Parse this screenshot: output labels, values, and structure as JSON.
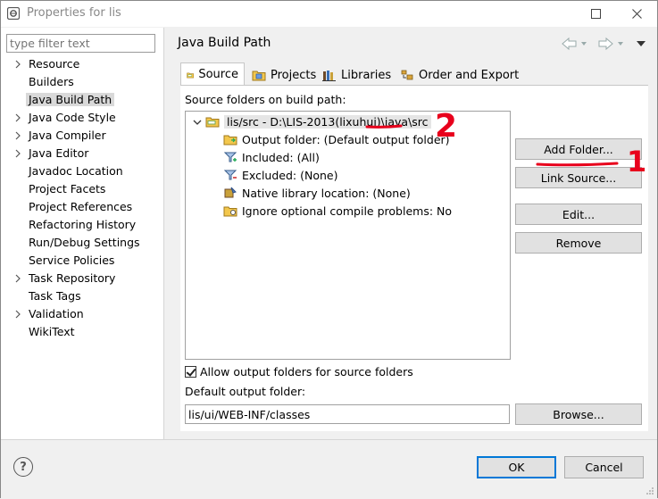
{
  "window": {
    "title": "Properties for lis"
  },
  "filter": {
    "placeholder": "type filter text"
  },
  "sidebar": {
    "items": [
      {
        "label": "Resource",
        "expandable": true
      },
      {
        "label": "Builders",
        "expandable": false
      },
      {
        "label": "Java Build Path",
        "expandable": false,
        "selected": true
      },
      {
        "label": "Java Code Style",
        "expandable": true
      },
      {
        "label": "Java Compiler",
        "expandable": true
      },
      {
        "label": "Java Editor",
        "expandable": true
      },
      {
        "label": "Javadoc Location",
        "expandable": false
      },
      {
        "label": "Project Facets",
        "expandable": false
      },
      {
        "label": "Project References",
        "expandable": false
      },
      {
        "label": "Refactoring History",
        "expandable": false
      },
      {
        "label": "Run/Debug Settings",
        "expandable": false
      },
      {
        "label": "Service Policies",
        "expandable": false
      },
      {
        "label": "Task Repository",
        "expandable": true
      },
      {
        "label": "Task Tags",
        "expandable": false
      },
      {
        "label": "Validation",
        "expandable": true
      },
      {
        "label": "WikiText",
        "expandable": false
      }
    ]
  },
  "page": {
    "title": "Java Build Path"
  },
  "tabs": [
    {
      "label": "Source",
      "icon": "source-folder-icon",
      "active": true
    },
    {
      "label": "Projects",
      "icon": "projects-icon",
      "active": false
    },
    {
      "label": "Libraries",
      "icon": "libraries-icon",
      "active": false
    },
    {
      "label": "Order and Export",
      "icon": "order-export-icon",
      "active": false
    }
  ],
  "source": {
    "list_label": "Source folders on build path:",
    "root": "lis/src - D:\\LIS-2013(lixuhui)\\java\\src",
    "children": [
      {
        "label": "Output folder: (Default output folder)",
        "icon": "output-folder-icon"
      },
      {
        "label": "Included: (All)",
        "icon": "included-filter-icon"
      },
      {
        "label": "Excluded: (None)",
        "icon": "excluded-filter-icon"
      },
      {
        "label": "Native library location: (None)",
        "icon": "native-library-icon"
      },
      {
        "label": "Ignore optional compile problems: No",
        "icon": "ignore-problems-icon"
      }
    ],
    "buttons": {
      "add_folder": "Add Folder...",
      "link_source": "Link Source...",
      "edit": "Edit...",
      "remove": "Remove"
    },
    "allow_output_label": "Allow output folders for source folders",
    "allow_output_checked": true,
    "default_output_label": "Default output folder:",
    "default_output_value": "lis/ui/WEB-INF/classes",
    "browse": "Browse..."
  },
  "footer": {
    "ok": "OK",
    "cancel": "Cancel"
  },
  "annotations": {
    "mark_1": "1",
    "mark_2": "2",
    "color": "#e8001c"
  },
  "colors": {
    "accent": "#0078d7",
    "selection": "#d9d9d9",
    "folder": "#e8b230"
  }
}
